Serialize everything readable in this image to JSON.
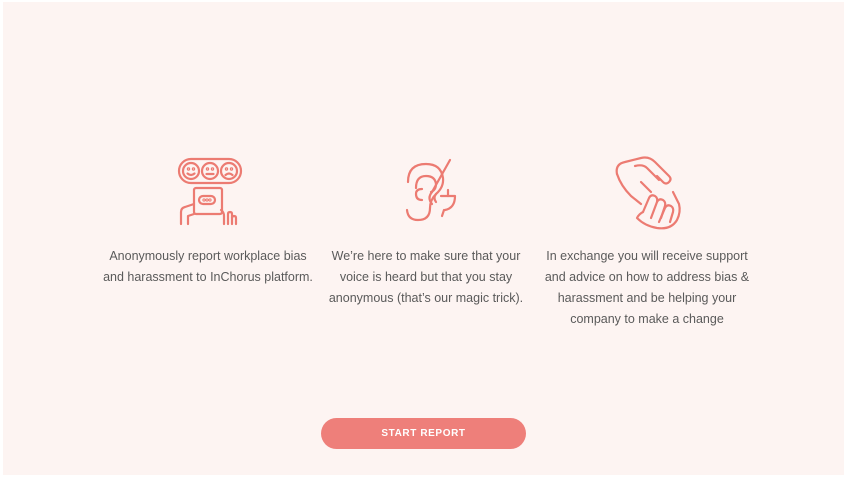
{
  "colors": {
    "background": "#fdf4f2",
    "accent": "#ee7f7a",
    "icon_stroke": "#ec7b72",
    "body_text": "#5a5a5a"
  },
  "features": [
    {
      "icon": "feedback-faces-icon",
      "text": "Anonymously report workplace bias and harassment to InChorus platform."
    },
    {
      "icon": "ear-listening-icon",
      "text": "We’re here to make sure that your voice is heard but that you stay anonymous (that’s our magic trick)."
    },
    {
      "icon": "helping-hands-icon",
      "text": "In exchange you will receive support and advice on how to address bias & harassment and be helping your company to make a change"
    }
  ],
  "cta": {
    "label": "START REPORT"
  }
}
